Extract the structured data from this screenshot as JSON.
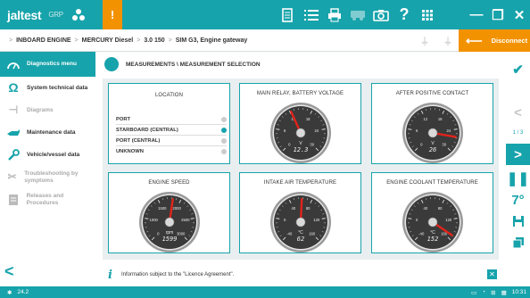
{
  "app": {
    "logo": "jaltest",
    "logo_sub": "GRP",
    "warning_icon": "!"
  },
  "toolbar": {
    "icons": [
      "document-icon",
      "list-icon",
      "print-icon",
      "bus-icon",
      "camera-icon",
      "help-icon",
      "grid-icon"
    ]
  },
  "window": {
    "minimize": "—",
    "restore": "❐",
    "close": "✕"
  },
  "breadcrumb": [
    "INBOARD ENGINE",
    "MERCURY Diesel",
    "3.0 150",
    "SIM G3, Engine gateway"
  ],
  "disconnect_label": "Disconnect",
  "sidebar": {
    "items": [
      {
        "label": "Diagnostics menu",
        "icon": "gauge-icon",
        "state": "active"
      },
      {
        "label": "System technical data",
        "icon": "ohm-icon",
        "state": "normal"
      },
      {
        "label": "Diagrams",
        "icon": "diagram-icon",
        "state": "disabled"
      },
      {
        "label": "Maintenance data",
        "icon": "oil-can-icon",
        "state": "normal"
      },
      {
        "label": "Vehicle/vessel data",
        "icon": "wrench-icon",
        "state": "normal"
      },
      {
        "label": "Troubleshooting by symptoms",
        "icon": "tools-icon",
        "state": "disabled"
      },
      {
        "label": "Releases and Procedures",
        "icon": "doc-icon",
        "state": "disabled"
      }
    ]
  },
  "main": {
    "title": "MEASUREMENTS \\ MEASUREMENT SELECTION"
  },
  "location": {
    "title": "LOCATION",
    "options": [
      {
        "label": "PORT",
        "selected": false
      },
      {
        "label": "STARBOARD (CENTRAL)",
        "selected": true
      },
      {
        "label": "PORT (CENTRAL)",
        "selected": false
      },
      {
        "label": "UNKNOWN",
        "selected": false
      }
    ]
  },
  "gauges": [
    {
      "title": "MAIN RELAY, BATTERY VOLTAGE",
      "unit": "V",
      "value": "12.3",
      "ticks": [
        "0",
        "6",
        "12",
        "18",
        "24",
        "30"
      ],
      "needle": 0.41
    },
    {
      "title": "AFTER POSITIVE CONTACT",
      "unit": "V",
      "value": "26",
      "ticks": [
        "0",
        "6",
        "12",
        "18",
        "24",
        "30"
      ],
      "needle": 0.87
    },
    {
      "title": "ENGINE SPEED",
      "unit": "rpm",
      "value": "1599",
      "ticks": [
        "0",
        "1000",
        "1500",
        "2000",
        "2500",
        "3000"
      ],
      "needle": 0.53
    },
    {
      "title": "INTAKE AIR TEMPERATURE",
      "unit": "°C",
      "value": "62",
      "ticks": [
        "-40",
        "0",
        "40",
        "80",
        "120",
        "160"
      ],
      "needle": 0.51
    },
    {
      "title": "ENGINE COOLANT TEMPERATURE",
      "unit": "°C",
      "value": "152",
      "ticks": [
        "-40",
        "0",
        "40",
        "80",
        "120",
        "160"
      ],
      "needle": 0.96
    }
  ],
  "info": {
    "text": "Information subject to the \"Licence Agreement\"."
  },
  "right_panel": {
    "page": "1 / 3"
  },
  "status": {
    "version": "24.2",
    "time": "10:31"
  },
  "colors": {
    "accent": "#17a3ab",
    "warning": "#f39200",
    "needle": "#e2231a"
  }
}
